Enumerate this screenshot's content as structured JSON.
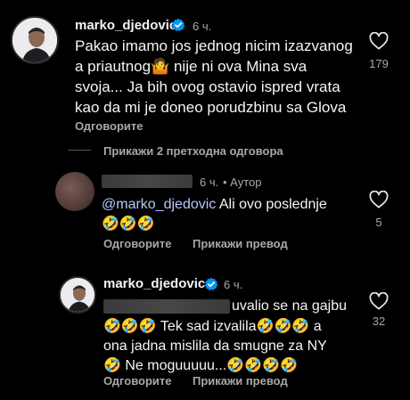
{
  "comments": [
    {
      "username": "marko_djedovic",
      "time": "6 ч.",
      "text_lines": [
        "Pakao imamo jos jednog nicim izazvanog",
        "a priautnog🤷 nije ni ova Mina sva",
        "svoja... Ja bih ovog ostavio ispred vrata",
        "kao da mi je doneo porudzbinu sa Glova"
      ],
      "likes": "179",
      "reply_label": "Одговорите"
    }
  ],
  "view_previous_replies": "Прикажи 2 претходна одговора",
  "reply1": {
    "time": "6 ч.",
    "author_tag": "• Аутор",
    "mention": "@marko_djedovic",
    "text_rest": " Ali ovo poslednje",
    "emoji_line": "🤣🤣🤣",
    "likes": "5",
    "reply_label": "Одговорите",
    "translate_label": "Прикажи превод"
  },
  "reply2": {
    "username": "marko_djedovic",
    "time": "6 ч.",
    "text_line1_rest": "uvalio se na gajbu",
    "text_line2": "🤣🤣🤣 Tek sad izvalila🤣🤣🤣 a",
    "text_line3": "ona jadna mislila da smugne za NY",
    "text_line4": "🤣 Ne moguuuuu...🤣🤣🤣🤣",
    "likes": "32",
    "reply_label": "Одговорите",
    "translate_label": "Прикажи превод"
  },
  "colors": {
    "background": "#000000",
    "verified": "#0095f6",
    "muted": "#a8a8a8"
  },
  "icons": [
    "verified-badge-icon",
    "heart-icon"
  ]
}
